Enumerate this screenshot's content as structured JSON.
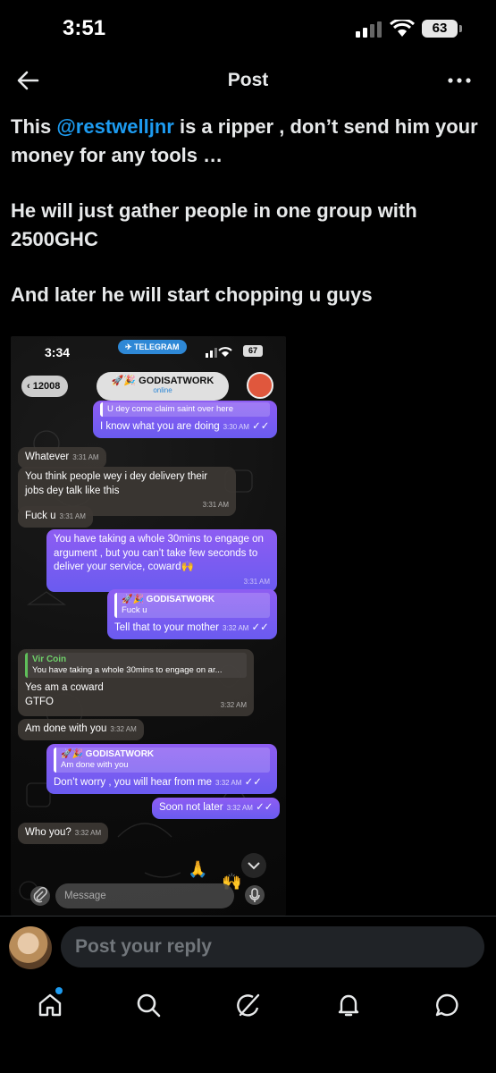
{
  "status_bar": {
    "time": "3:51",
    "battery": "63"
  },
  "header": {
    "title": "Post"
  },
  "post": {
    "para1_pre": "This ",
    "mention": "@restwelljnr",
    "para1_post": " is a ripper , don’t send him your money for any tools …",
    "para2": "He will just gather people in one group with 2500GHC",
    "para3": "And later he will start chopping u guys"
  },
  "telegram": {
    "time": "3:34",
    "pill": "TELEGRAM",
    "battery": "67",
    "back_count": "12008",
    "chat_name": "🚀🎉 GODISATWORK",
    "chat_status": "online",
    "messages": [
      {
        "id": "m1",
        "dir": "out",
        "reply_text": "U dey come claim saint over here",
        "text": "I know what you are doing",
        "time": "3:30 AM"
      },
      {
        "id": "m2",
        "dir": "in",
        "text": "Whatever",
        "time": "3:31 AM"
      },
      {
        "id": "m3",
        "dir": "in",
        "text": "You think people wey i dey delivery their jobs dey talk like this",
        "time": "3:31 AM"
      },
      {
        "id": "m4",
        "dir": "in",
        "text": "Fuck u",
        "time": "3:31 AM"
      },
      {
        "id": "m5",
        "dir": "out",
        "text": "You have taking a whole 30mins to engage on argument , but you can’t take few seconds to deliver your service, coward🙌",
        "time": "3:31 AM"
      },
      {
        "id": "m6",
        "dir": "out",
        "reply_name": "🚀🎉 GODISATWORK",
        "reply_text": "Fuck u",
        "text": "Tell that to your mother",
        "time": "3:32 AM"
      },
      {
        "id": "m7",
        "dir": "in",
        "reply_name": "Vir Coin",
        "reply_text": "You have taking a whole 30mins to engage on ar...",
        "text1": "Yes am a coward",
        "text2": "GTFO",
        "time": "3:32 AM"
      },
      {
        "id": "m8",
        "dir": "in",
        "text": "Am done with you",
        "time": "3:32 AM"
      },
      {
        "id": "m9",
        "dir": "out",
        "reply_name": "🚀🎉 GODISATWORK",
        "reply_text": "Am done with you",
        "text": "Don’t worry , you will hear from me",
        "time": "3:32 AM"
      },
      {
        "id": "m10",
        "dir": "out",
        "text": "Soon not later",
        "time": "3:32 AM"
      },
      {
        "id": "m11",
        "dir": "in",
        "text": "Who you?",
        "time": "3:32 AM"
      }
    ],
    "input_placeholder": "Message"
  },
  "reply_bar": {
    "placeholder": "Post your reply"
  },
  "tabs": [
    "home-icon",
    "search-icon",
    "grok-icon",
    "notifications-icon",
    "messages-icon"
  ]
}
